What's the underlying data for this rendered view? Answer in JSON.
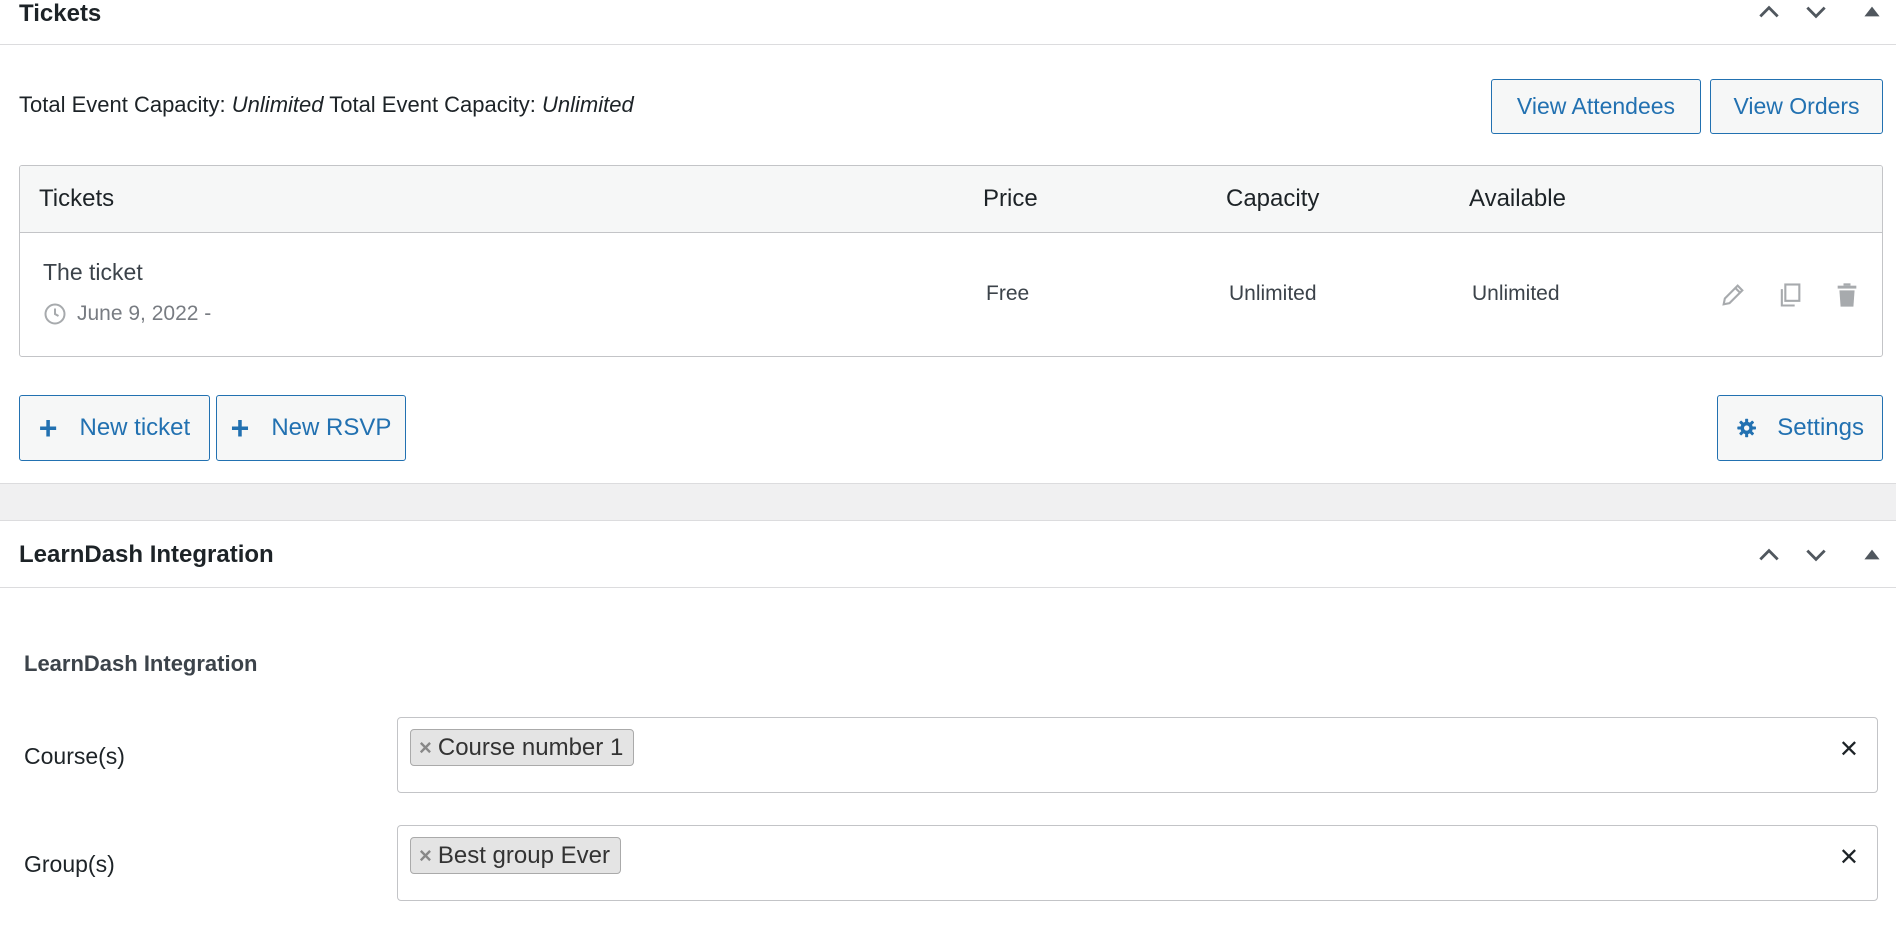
{
  "tickets_box": {
    "title": "Tickets",
    "capacity_label_1": "Total Event Capacity:",
    "capacity_value_1": "Unlimited",
    "capacity_label_2": "Total Event Capacity:",
    "capacity_value_2": "Unlimited",
    "view_attendees": "View Attendees",
    "view_orders": "View Orders",
    "table": {
      "headers": [
        "Tickets",
        "Price",
        "Capacity",
        "Available"
      ],
      "rows": [
        {
          "name": "The ticket",
          "date": "June 9, 2022 -",
          "price": "Free",
          "capacity": "Unlimited",
          "available": "Unlimited"
        }
      ]
    },
    "new_ticket": "New ticket",
    "new_rsvp": "New RSVP",
    "settings": "Settings"
  },
  "learndash_box": {
    "title": "LearnDash Integration",
    "section_label": "LearnDash Integration",
    "fields": [
      {
        "label": "Course(s)",
        "selected": "Course number 1"
      },
      {
        "label": "Group(s)",
        "selected": "Best group Ever"
      }
    ]
  },
  "icons": {
    "move_up": "chevron-up-icon",
    "move_down": "chevron-down-icon",
    "toggle": "triangle-up-icon",
    "edit": "pencil-icon",
    "duplicate": "copy-icon",
    "delete": "trash-icon",
    "clock": "clock-icon",
    "settings": "gear-icon"
  },
  "colors": {
    "accent": "#2271b1",
    "icon_gray": "#a7aaad",
    "border": "#c3c4c7"
  }
}
